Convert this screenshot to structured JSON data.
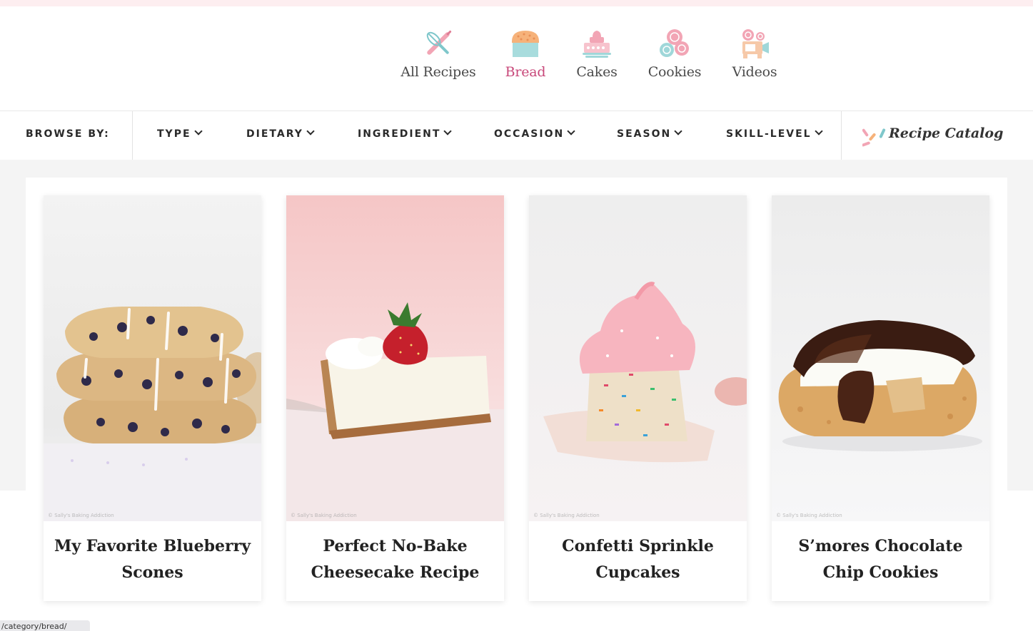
{
  "category_nav": {
    "items": [
      {
        "label": "All Recipes",
        "icon": "rolling-pin-whisk-icon"
      },
      {
        "label": "Bread",
        "icon": "bread-loaf-icon",
        "active": true
      },
      {
        "label": "Cakes",
        "icon": "cake-icon"
      },
      {
        "label": "Cookies",
        "icon": "cookies-icon"
      },
      {
        "label": "Videos",
        "icon": "video-camera-icon"
      }
    ],
    "active_color": "#c8487a"
  },
  "browse_bar": {
    "label": "BROWSE BY:",
    "filters": [
      "TYPE",
      "DIETARY",
      "INGREDIENT",
      "OCCASION",
      "SEASON",
      "SKILL-LEVEL"
    ],
    "catalog_label": "Recipe Catalog",
    "catalog_icon": "sprinkles-icon"
  },
  "cards": [
    {
      "title": "My Favorite Blueberry Scones",
      "image": "blueberry-scones-photo",
      "watermark": "© Sally's Baking Addiction"
    },
    {
      "title": "Perfect No-Bake Cheesecake Recipe",
      "image": "no-bake-cheesecake-photo",
      "watermark": "© Sally's Baking Addiction"
    },
    {
      "title": "Confetti Sprinkle Cupcakes",
      "image": "confetti-cupcake-photo",
      "watermark": "© Sally's Baking Addiction"
    },
    {
      "title": "S’mores Chocolate Chip Cookies",
      "image": "smores-cookie-photo",
      "watermark": "© Sally's Baking Addiction"
    }
  ],
  "status_bar": {
    "url": "/category/bread/"
  },
  "colors": {
    "accent_pink": "#c8487a",
    "icon_pink": "#f2a5b5",
    "icon_teal": "#9fd7d9",
    "background_grey": "#f4f4f4"
  }
}
